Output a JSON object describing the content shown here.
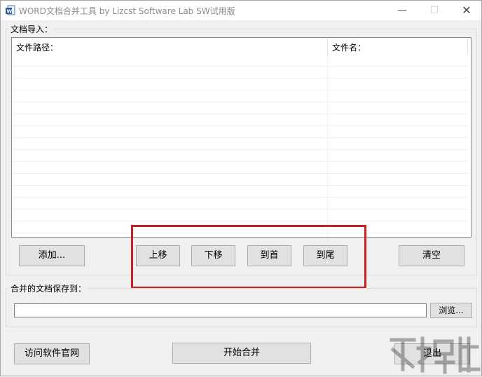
{
  "window": {
    "title": "WORD文档合并工具    by Lizcst Software Lab   SW试用版",
    "controls": {
      "minimize": "—",
      "maximize": "☐",
      "close": "✕"
    }
  },
  "import_group": {
    "label": "文档导入：",
    "columns": [
      "文件路径：",
      "文件名："
    ],
    "rows": []
  },
  "buttons": {
    "add": "添加...",
    "move_up": "上移",
    "move_down": "下移",
    "to_top": "到首",
    "to_bottom": "到尾",
    "clear": "清空",
    "browse": "浏览...",
    "visit_site": "访问软件官网",
    "start_merge": "开始合并",
    "exit": "退出"
  },
  "save_group": {
    "label": "合并的文档保存到：",
    "path_value": ""
  },
  "colors": {
    "highlight": "#cc1f24",
    "window_bg": "#f0f0f0",
    "button_bg": "#e1e1e1"
  },
  "icons": {
    "app": "word-doc-icon",
    "watermark": "watermark-logo"
  }
}
